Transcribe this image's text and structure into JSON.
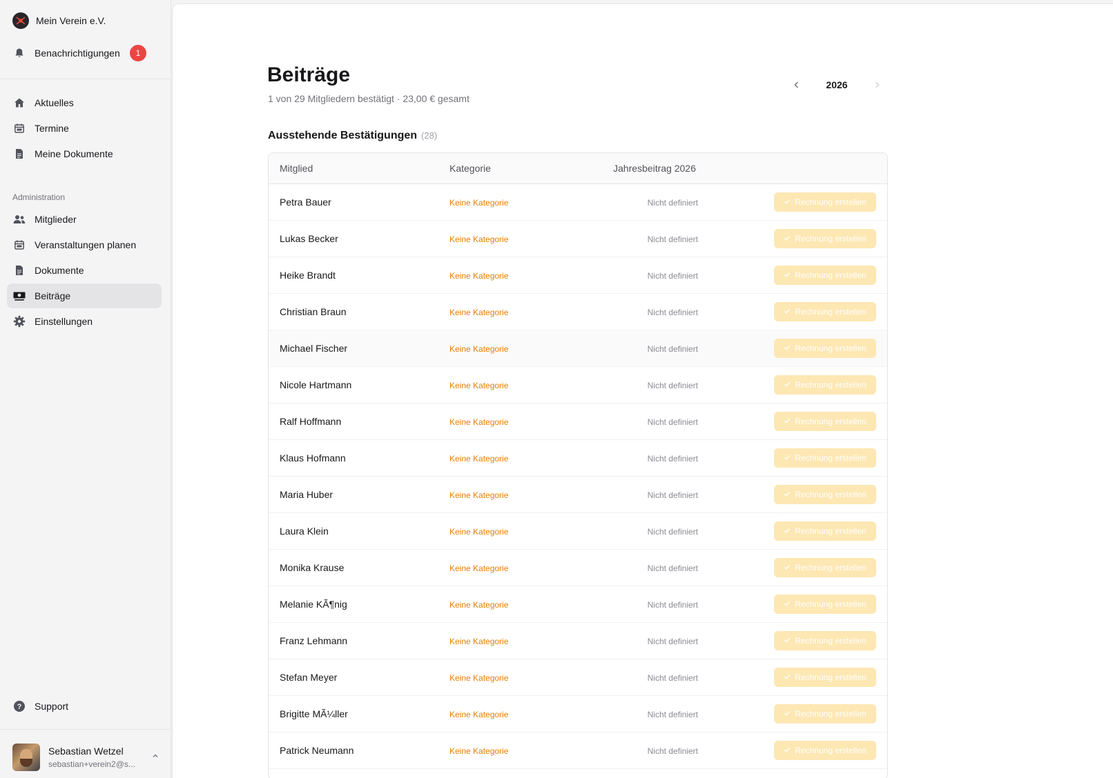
{
  "sidebar": {
    "org_name": "Mein Verein e.V.",
    "notifications": {
      "label": "Benachrichtigungen",
      "count": "1"
    },
    "main_items": [
      {
        "label": "Aktuelles",
        "icon": "home-icon"
      },
      {
        "label": "Termine",
        "icon": "calendar-icon"
      },
      {
        "label": "Meine Dokumente",
        "icon": "document-icon"
      }
    ],
    "admin_section": "Administration",
    "admin_items": [
      {
        "label": "Mitglieder",
        "icon": "users-icon"
      },
      {
        "label": "Veranstaltungen planen",
        "icon": "calendar-icon"
      },
      {
        "label": "Dokumente",
        "icon": "document-icon"
      },
      {
        "label": "Beiträge",
        "icon": "money-icon",
        "active": true
      },
      {
        "label": "Einstellungen",
        "icon": "gear-icon"
      }
    ],
    "support": "Support",
    "user": {
      "name": "Sebastian Wetzel",
      "email": "sebastian+verein2@s..."
    }
  },
  "page": {
    "title": "Beiträge",
    "subtitle": "1 von 29 Mitgliedern bestätigt · 23,00 € gesamt",
    "year": "2026"
  },
  "pending": {
    "title": "Ausstehende Bestätigungen",
    "count": "(28)",
    "columns": [
      "Mitglied",
      "Kategorie",
      "Jahresbeitrag 2026"
    ],
    "button_label": "Rechnung erstellen",
    "rows": [
      {
        "name": "Petra Bauer",
        "category": "Keine Kategorie",
        "amount": "Nicht definiert"
      },
      {
        "name": "Lukas Becker",
        "category": "Keine Kategorie",
        "amount": "Nicht definiert"
      },
      {
        "name": "Heike Brandt",
        "category": "Keine Kategorie",
        "amount": "Nicht definiert"
      },
      {
        "name": "Christian Braun",
        "category": "Keine Kategorie",
        "amount": "Nicht definiert"
      },
      {
        "name": "Michael Fischer",
        "category": "Keine Kategorie",
        "amount": "Nicht definiert"
      },
      {
        "name": "Nicole Hartmann",
        "category": "Keine Kategorie",
        "amount": "Nicht definiert"
      },
      {
        "name": "Ralf Hoffmann",
        "category": "Keine Kategorie",
        "amount": "Nicht definiert"
      },
      {
        "name": "Klaus Hofmann",
        "category": "Keine Kategorie",
        "amount": "Nicht definiert"
      },
      {
        "name": "Maria Huber",
        "category": "Keine Kategorie",
        "amount": "Nicht definiert"
      },
      {
        "name": "Laura Klein",
        "category": "Keine Kategorie",
        "amount": "Nicht definiert"
      },
      {
        "name": "Monika Krause",
        "category": "Keine Kategorie",
        "amount": "Nicht definiert"
      },
      {
        "name": "Melanie KÃ¶nig",
        "category": "Keine Kategorie",
        "amount": "Nicht definiert"
      },
      {
        "name": "Franz Lehmann",
        "category": "Keine Kategorie",
        "amount": "Nicht definiert"
      },
      {
        "name": "Stefan Meyer",
        "category": "Keine Kategorie",
        "amount": "Nicht definiert"
      },
      {
        "name": "Brigitte MÃ¼ller",
        "category": "Keine Kategorie",
        "amount": "Nicht definiert"
      },
      {
        "name": "Patrick Neumann",
        "category": "Keine Kategorie",
        "amount": "Nicht definiert"
      }
    ]
  },
  "colors": {
    "accent_orange": "#e67e00",
    "button_disabled": "#fde7b3",
    "badge_red": "#ef4444"
  }
}
